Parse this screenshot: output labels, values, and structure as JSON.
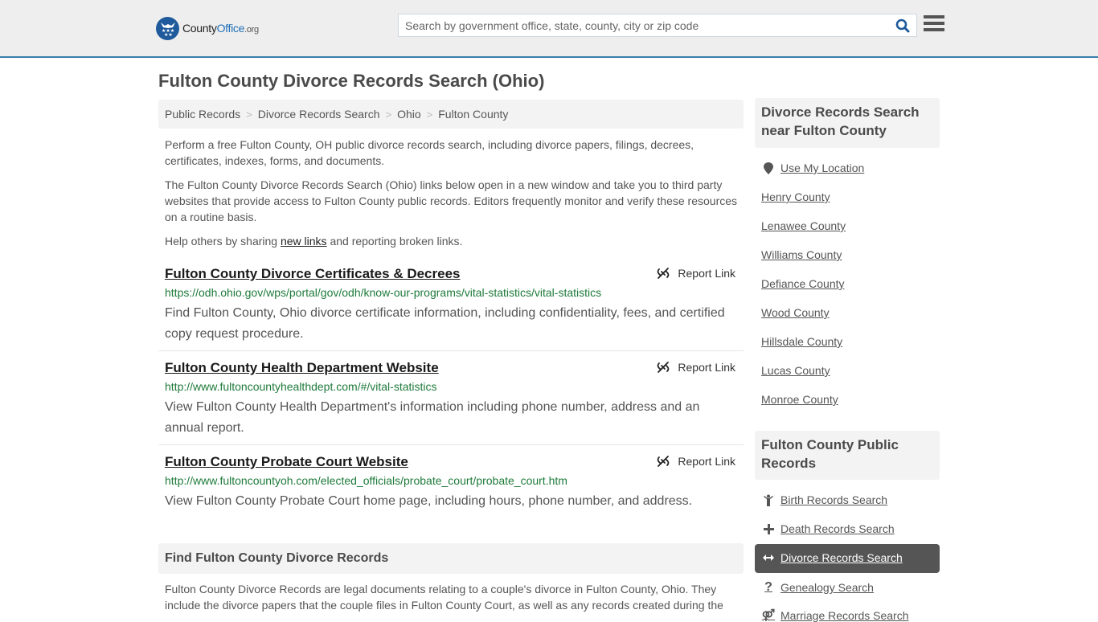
{
  "header": {
    "logo": {
      "name": "County",
      "accent": "Office",
      "tld": ".org"
    },
    "search": {
      "placeholder": "Search by government office, state, county, city or zip code",
      "value": ""
    }
  },
  "page": {
    "title": "Fulton County Divorce Records Search (Ohio)"
  },
  "breadcrumb": [
    {
      "label": "Public Records"
    },
    {
      "label": "Divorce Records Search"
    },
    {
      "label": "Ohio"
    },
    {
      "label": "Fulton County"
    }
  ],
  "intro": {
    "p1": "Perform a free Fulton County, OH public divorce records search, including divorce papers, filings, decrees, certificates, indexes, forms, and documents.",
    "p2": "The Fulton County Divorce Records Search (Ohio) links below open in a new window and take you to third party websites that provide access to Fulton County public records. Editors frequently monitor and verify these resources on a routine basis.",
    "p3_before": "Help others by sharing ",
    "p3_link": "new links",
    "p3_after": " and reporting broken links."
  },
  "results": [
    {
      "title": "Fulton County Divorce Certificates & Decrees",
      "url": "https://odh.ohio.gov/wps/portal/gov/odh/know-our-programs/vital-statistics/vital-statistics",
      "description": "Find Fulton County, Ohio divorce certificate information, including confidentiality, fees, and certified copy request procedure.",
      "report_label": "Report Link"
    },
    {
      "title": "Fulton County Health Department Website",
      "url": "http://www.fultoncountyhealthdept.com/#/vital-statistics",
      "description": "View Fulton County Health Department's information including phone number, address and an annual report.",
      "report_label": "Report Link"
    },
    {
      "title": "Fulton County Probate Court Website",
      "url": "http://www.fultoncountyoh.com/elected_officials/probate_court/probate_court.htm",
      "description": "View Fulton County Probate Court home page, including hours, phone number, and address.",
      "report_label": "Report Link"
    }
  ],
  "find_section": {
    "heading": "Find Fulton County Divorce Records",
    "body": "Fulton County Divorce Records are legal documents relating to a couple's divorce in Fulton County, Ohio. They include the divorce papers that the couple files in Fulton County Court, as well as any records created during the"
  },
  "sidebar": {
    "nearby_heading": "Divorce Records Search near Fulton County",
    "use_location": "Use My Location",
    "nearby": [
      "Henry County",
      "Lenawee County",
      "Williams County",
      "Defiance County",
      "Wood County",
      "Hillsdale County",
      "Lucas County",
      "Monroe County"
    ],
    "public_records_heading": "Fulton County Public Records",
    "public_records": [
      {
        "label": "Birth Records Search",
        "icon": "child-icon",
        "active": false
      },
      {
        "label": "Death Records Search",
        "icon": "plus-icon",
        "active": false
      },
      {
        "label": "Divorce Records Search",
        "icon": "arrows-h-icon",
        "active": true
      },
      {
        "label": "Genealogy Search",
        "icon": "question-icon",
        "active": false
      },
      {
        "label": "Marriage Records Search",
        "icon": "marriage-icon",
        "active": false
      }
    ]
  },
  "colors": {
    "brand_blue": "#1f5a9c",
    "header_border": "#3a7eac",
    "url_green": "#1e7a3a",
    "active_bg": "#555555"
  }
}
